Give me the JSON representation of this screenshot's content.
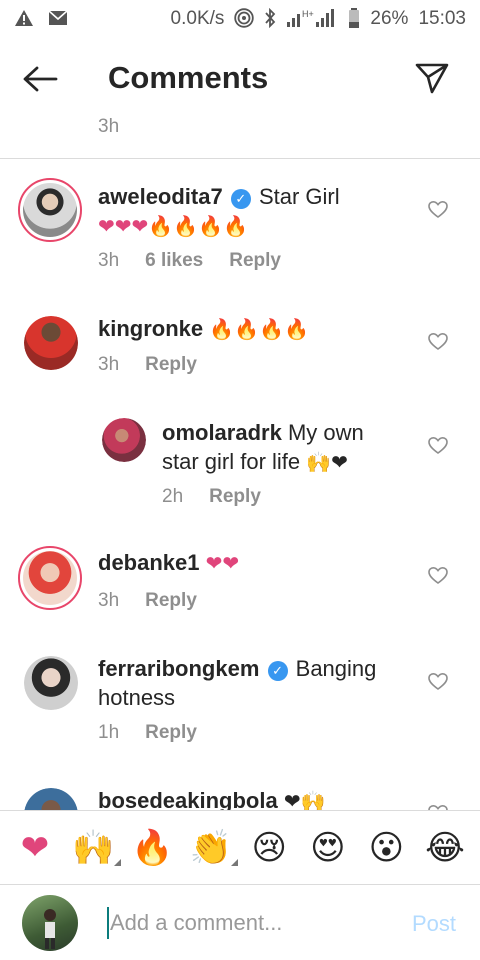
{
  "status_bar": {
    "speed": "0.0K/s",
    "network": "H+",
    "battery": "26%",
    "time": "15:03"
  },
  "header": {
    "title": "Comments"
  },
  "top_time": "3h",
  "comments": [
    {
      "username": "aweleodita7",
      "verified": true,
      "text": "Star Girl",
      "emoji": "❤❤❤🔥🔥🔥🔥",
      "time": "3h",
      "likes": "6 likes",
      "reply": "Reply"
    },
    {
      "username": "kingronke",
      "verified": false,
      "text": "",
      "emoji": "🔥🔥🔥🔥",
      "time": "3h",
      "reply": "Reply"
    },
    {
      "username": "omolaradrk",
      "verified": false,
      "text": "My own",
      "text2": "star girl for life",
      "emoji": "🙌❤",
      "time": "2h",
      "reply": "Reply"
    },
    {
      "username": "debanke1",
      "verified": false,
      "text": "",
      "emoji": "❤❤",
      "time": "3h",
      "reply": "Reply"
    },
    {
      "username": "ferraribongkem",
      "verified": true,
      "text": "Banging",
      "text2": "hotness",
      "time": "1h",
      "reply": "Reply"
    },
    {
      "username": "bosedeakingbola",
      "verified": false,
      "emoji": "❤🙌"
    }
  ],
  "emoji_bar": [
    "❤",
    "🙌",
    "🔥",
    "👏",
    "😢",
    "😍",
    "😮",
    "😂"
  ],
  "composer": {
    "placeholder": "Add a comment...",
    "post_label": "Post"
  },
  "colors": {
    "accent_blue": "#3897f0",
    "post_disabled": "#b3dbff",
    "heart_pink": "#e0457b",
    "ring": "#e8466a"
  }
}
